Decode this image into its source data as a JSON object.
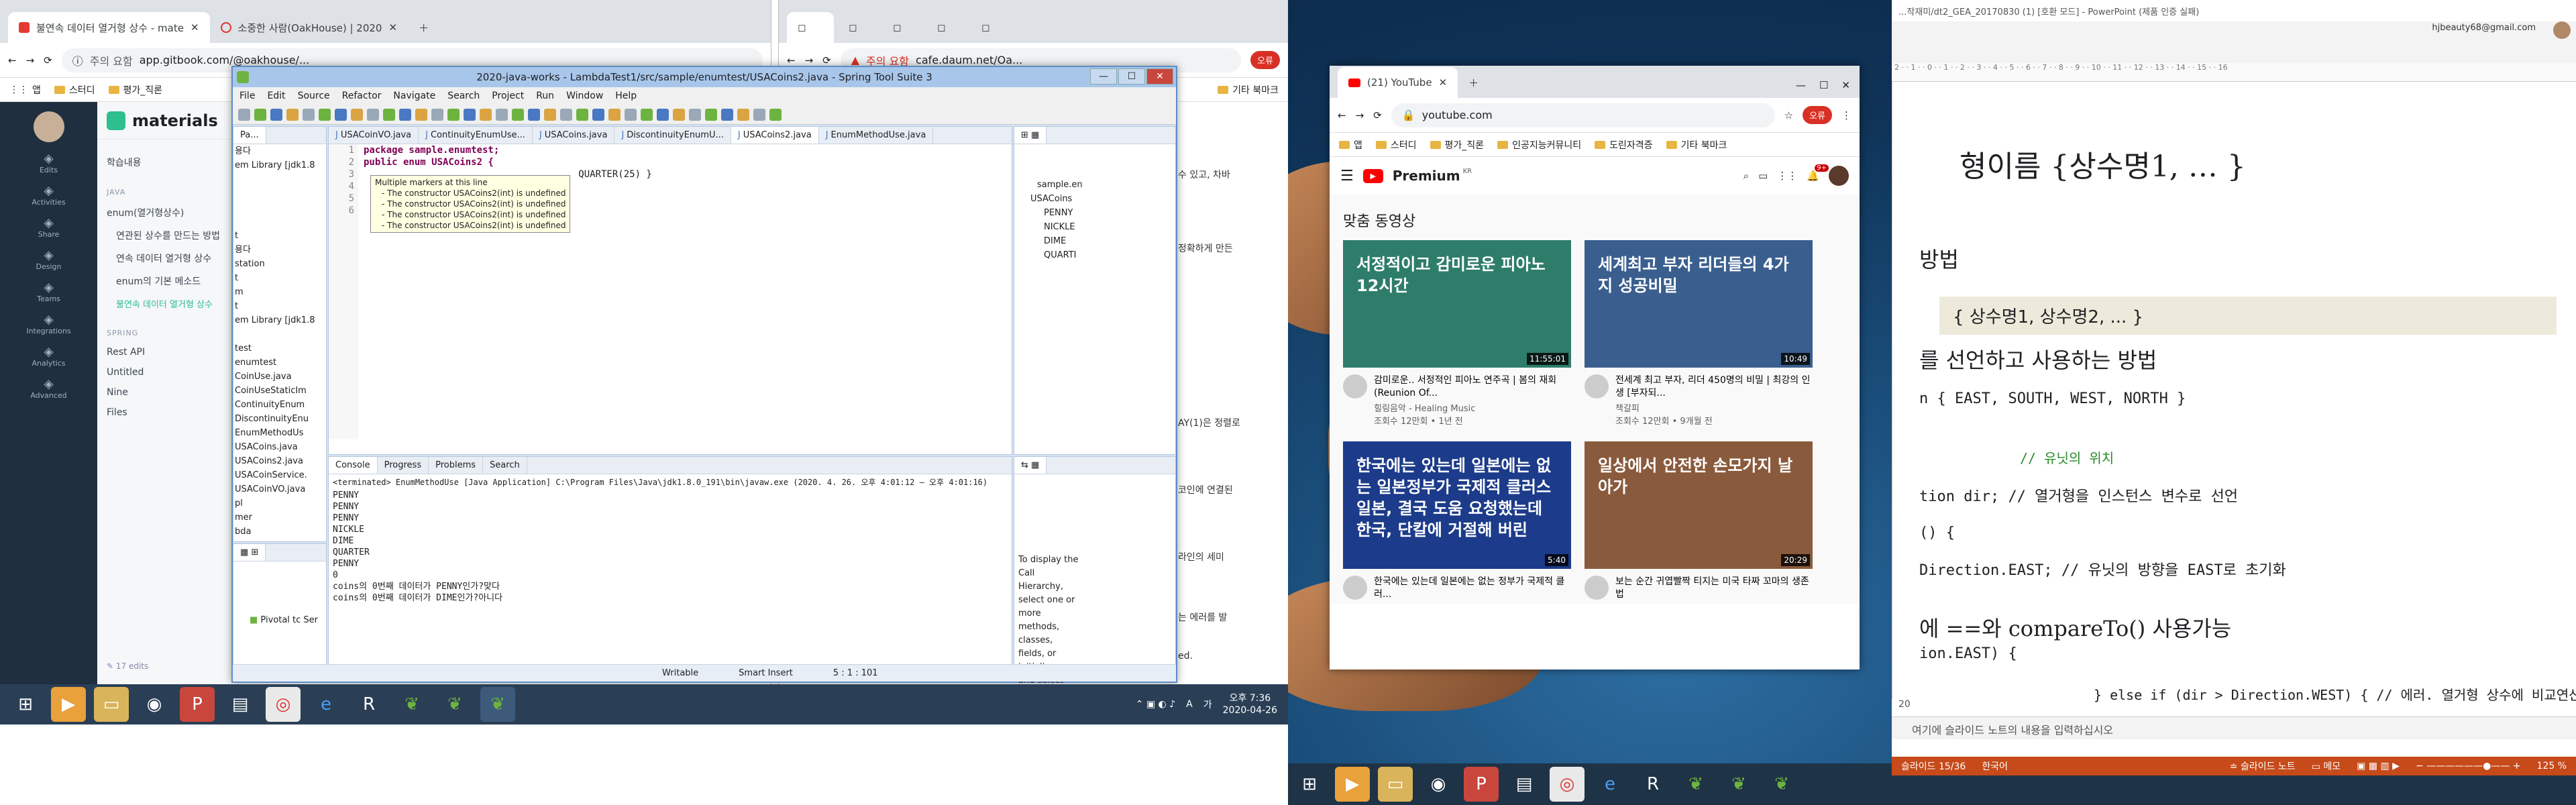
{
  "left_browser": {
    "tabs": [
      {
        "label": "불연속 데이터 열거형 상수 - mate"
      },
      {
        "label": "소중한 사람(OakHouse) | 2020"
      }
    ],
    "url": "app.gitbook.com/@oakhouse/...",
    "security": "주의 요함",
    "bookmarks": [
      "앱",
      "스터디",
      "평가_직론",
      "기타 북마크"
    ],
    "sidebar_icons": [
      "Edits",
      "Activities",
      "Share",
      "Design",
      "Teams",
      "Integrations",
      "Analytics",
      "Advanced"
    ],
    "book_title": "materials",
    "nav": [
      {
        "label": "학습내용",
        "section": false
      },
      {
        "label": "JAVA",
        "section": true
      },
      {
        "label": "enum(열거형상수)",
        "section": false
      },
      {
        "label": "연관된 상수를 만드는 방법",
        "section": false
      },
      {
        "label": "연속 데이터 열거형 상수",
        "section": false
      },
      {
        "label": "enum의 기본 메소드",
        "section": false
      },
      {
        "label": "불연속 데이터 열거형 상수",
        "section": false,
        "active": true
      },
      {
        "label": "SPRING",
        "section": true
      },
      {
        "label": "Rest API",
        "section": false
      },
      {
        "label": "Untitled",
        "section": false
      },
      {
        "label": "Nine",
        "section": false
      },
      {
        "label": "Files",
        "section": false
      }
    ],
    "edits": "17 edits",
    "article_fragments": [
      "수 있고, 차바",
      "정확하게 만든",
      "AY(1)은 정렬로",
      "코인에 연결된",
      "라인의 세미",
      "는 에러를 발",
      "ed."
    ]
  },
  "second_browser": {
    "url": "cafe.daum.net/Oa...",
    "security": "주의 요함",
    "bookmarks_right": "기타 북마크",
    "profile": "오류"
  },
  "sts": {
    "title": "2020-java-works - LambdaTest1/src/sample/enumtest/USACoins2.java - Spring Tool Suite 3",
    "menu": [
      "File",
      "Edit",
      "Source",
      "Refactor",
      "Navigate",
      "Search",
      "Project",
      "Run",
      "Window",
      "Help"
    ],
    "editor_tabs": [
      "USACoinVO.java",
      "ContinuityEnumUse...",
      "USACoins.java",
      "DiscontinuityEnumU...",
      "USACoins2.java",
      "EnumMethodUse.java"
    ],
    "code_lines": [
      {
        "n": "1",
        "text": "package sample.enumtest;"
      },
      {
        "n": "2",
        "text": ""
      },
      {
        "n": "3",
        "text": "public enum USACoins2 {"
      },
      {
        "n": "4",
        "text": "                                      QUARTER(25) }"
      },
      {
        "n": "5",
        "text": ""
      },
      {
        "n": "6",
        "text": ""
      }
    ],
    "tooltip": {
      "title": "Multiple markers at this line",
      "items": [
        "- The constructor USACoins2(int) is undefined",
        "- The constructor USACoins2(int) is undefined",
        "- The constructor USACoins2(int) is undefined",
        "- The constructor USACoins2(int) is undefined"
      ]
    },
    "package_explorer": {
      "tab": "Pa...",
      "items": [
        "용다",
        "em Library [jdk1.8",
        "",
        "",
        "",
        "",
        "t",
        "용다",
        "station",
        "t",
        "m",
        "t",
        "em Library [jdk1.8",
        "",
        "test",
        "enumtest",
        "CoinUse.java",
        "CoinUseStaticIm",
        "ContinuityEnum",
        "DiscontinuityEnu",
        "EnumMethodUs",
        "USACoins.java",
        "USACoins2.java",
        "USACoinService.",
        "USACoinVO.java",
        "pl",
        "mer",
        "bda"
      ]
    },
    "outline": {
      "items": [
        "sample.en",
        "USACoins",
        "PENNY",
        "NICKLE",
        "DIME",
        "QUARTI"
      ]
    },
    "console": {
      "tabs": [
        "Console",
        "Progress",
        "Problems",
        "Search"
      ],
      "header": "<terminated> EnumMethodUse [Java Application] C:\\Program Files\\Java\\jdk1.8.0_191\\bin\\javaw.exe  (2020. 4. 26. 오후 4:01:12 – 오후 4:01:16)",
      "lines": [
        "PENNY",
        "PENNY",
        "PENNY",
        "NICKLE",
        "DIME",
        "QUARTER",
        "PENNY",
        "0",
        "coins의 0번째 데이터가 PENNY인가?맞다",
        "coins의 0번째 데이터가 DIME인가?아니다"
      ]
    },
    "call_hierarchy_help": "To display the Call Hierarchy, select one or more methods, classes, fields, or initializers, and select the 'Open Call Hierarchy' menu option. Alternatively, you can drag and drop the member or members onto this view.",
    "servers_item": "Pivotal tc Ser",
    "status": {
      "mode": "Writable",
      "insert": "Smart Insert",
      "position": "5 : 1 : 101"
    }
  },
  "left_taskbar": {
    "time": "오후 7:36",
    "date": "2020-04-26",
    "lang": "A"
  },
  "youtube": {
    "tab_label": "(21) YouTube",
    "url": "youtube.com",
    "bookmarks": [
      "앱",
      "스터디",
      "평가_직론",
      "인공지능커뮤니티",
      "도린자격증",
      "기타 북마크"
    ],
    "logo_suffix": "Premium",
    "locale": "KR",
    "notifications": "9+",
    "section_title": "맞춤 동영상",
    "videos": [
      {
        "thumb_text": "서정적이고 감미로운 피아노 12시간",
        "duration": "11:55:01",
        "title": "감미로운.. 서정적인 피아노 연주곡 | 봄의 재회 (Reunion Of...",
        "channel": "힐링음악 - Healing Music",
        "meta": "조회수 12만회 • 1년 전",
        "thumb_color": "#2e7d6b"
      },
      {
        "thumb_text": "세계최고 부자 리더들의 4가지 성공비밀",
        "duration": "10:49",
        "title": "전세계 최고 부자, 리더 450명의 비밀 | 최강의 인생 [부자되...",
        "channel": "책갈피",
        "meta": "조회수 12만회 • 9개월 전",
        "thumb_color": "#3a5f8f"
      },
      {
        "thumb_text": "한국에는 있는데 일본에는 없는 일본정부가 국제적 클러스 일본, 결국 도움 요청했는데 한국, 단칼에 거절해 버린",
        "duration": "5:40",
        "title": "한국에는 있는데 일본에는 없는 정부가 국제적 클러...",
        "channel": "",
        "meta": "",
        "thumb_color": "#1c3b8a"
      },
      {
        "thumb_text": "일상에서 안전한 손모가지 날아가",
        "duration": "20:29",
        "title": "보는 순간 귀엽빨짝 티지는 미국 타짜 꼬마의 생존법",
        "channel": "",
        "meta": "",
        "thumb_color": "#8a5a3c"
      }
    ]
  },
  "ppt": {
    "title": "...작재미/dt2_GEA_20170830 (1) [호환 모드] - PowerPoint (제품 인증 실패)",
    "user": "hjbeauty68@gmail.com",
    "slide_lines": [
      {
        "text": "형이름 {상수명1, … }",
        "style": "heading"
      },
      {
        "text": "방법",
        "style": "sub"
      },
      {
        "text": "{ 상수명1, 상수명2, ... }",
        "style": "box"
      },
      {
        "text": "를 선언하고 사용하는 방법",
        "style": "sub"
      },
      {
        "text": "n { EAST, SOUTH, WEST, NORTH }",
        "style": "code"
      },
      {
        "text": "// 유닛의 위치",
        "style": "comment"
      },
      {
        "text": "tion dir;      // 열거형을 인스턴스 변수로 선언",
        "style": "code"
      },
      {
        "text": "() {",
        "style": "code"
      },
      {
        "text": "Direction.EAST;  // 유닛의 방향을 EAST로 초기화",
        "style": "code"
      },
      {
        "text": "에 ==와 compareTo() 사용가능",
        "style": "sub"
      },
      {
        "text": "ion.EAST) {",
        "style": "code"
      },
      {
        "text": "} else if (dir > Direction.WEST) { // 에러. 열거형 상수에 비교연산자 사용불가",
        "style": "code"
      }
    ],
    "slide_number": "20",
    "notes_placeholder": "여기에 슬라이드 노트의 내용을 입력하십시오",
    "status_slide": "슬라이드 15/36",
    "status_lang": "한국어",
    "status_notes": "슬라이드 노트",
    "status_comments": "메모",
    "zoom": "125 %"
  },
  "right_taskbar": {
    "time": "오후 7:36",
    "date": "2020-04-26"
  }
}
